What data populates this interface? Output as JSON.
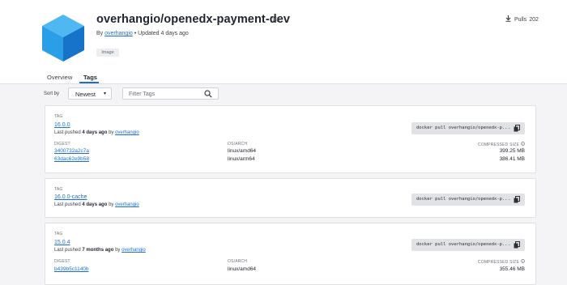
{
  "repo": {
    "title": "overhangio/openedx-payment-dev",
    "by_label": "By",
    "owner": "overhangio",
    "updated": "• Updated 4 days ago",
    "badge": "Image",
    "pulls_label": "Pulls",
    "pulls_count": "202"
  },
  "tabs": [
    {
      "label": "Overview"
    },
    {
      "label": "Tags"
    }
  ],
  "sort": {
    "label": "Sort by",
    "value": "Newest"
  },
  "filter": {
    "placeholder": "Filter Tags"
  },
  "columns": {
    "tag": "TAG",
    "digest": "DIGEST",
    "os_arch": "OS/ARCH",
    "compressed_size": "COMPRESSED SIZE"
  },
  "tags": [
    {
      "name": "16.0.0",
      "pushed_prefix": "Last pushed",
      "pushed_when": "4 days ago",
      "by": "by",
      "pusher": "overhangio",
      "pull_cmd": "docker pull overhangio/openedx-p...",
      "rows": [
        {
          "digest": "3400732a2c7a",
          "os": "linux/amd64",
          "size": "399.25 MB"
        },
        {
          "digest": "63dac62e9b58",
          "os": "linux/arm64",
          "size": "386.41 MB"
        }
      ]
    },
    {
      "name": "16.0.0-cache",
      "pushed_prefix": "Last pushed",
      "pushed_when": "4 days ago",
      "by": "by",
      "pusher": "overhangio",
      "pull_cmd": "docker pull overhangio/openedx-p...",
      "rows": []
    },
    {
      "name": "15.0.4",
      "pushed_prefix": "Last pushed",
      "pushed_when": "7 months ago",
      "by": "by",
      "pusher": "overhangio",
      "pull_cmd": "docker pull overhangio/openedx-p...",
      "rows": [
        {
          "digest": "b439b5c1140b",
          "os": "linux/amd64",
          "size": "355.46 MB"
        }
      ]
    }
  ],
  "colors": {
    "link": "#1c6fd1",
    "logo_top": "#4fb8f2",
    "logo_left": "#2a9ee6",
    "logo_right": "#1673c9"
  },
  "icons": [
    "cube-logo-icon",
    "star-icon",
    "download-icon",
    "chevron-down-icon",
    "search-icon",
    "copy-icon",
    "info-icon"
  ]
}
